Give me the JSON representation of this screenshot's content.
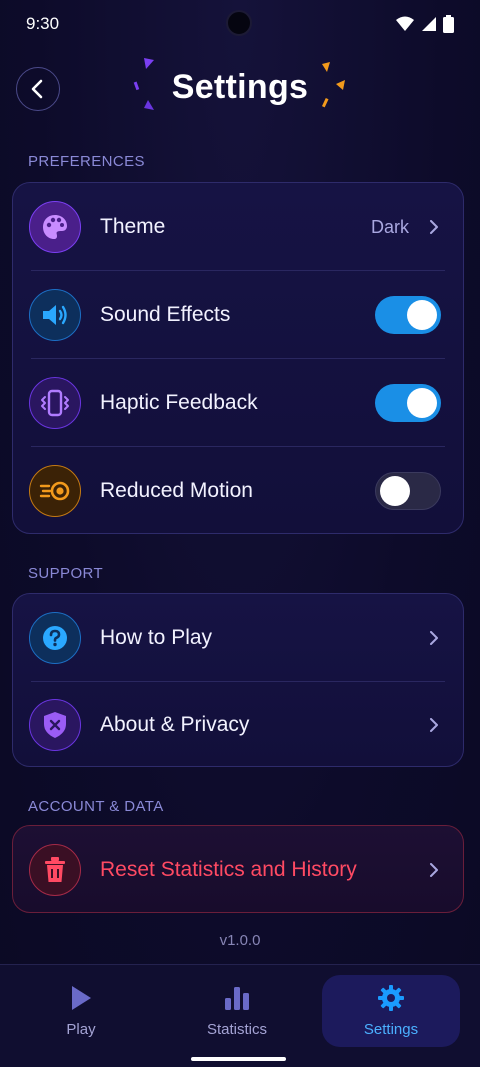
{
  "status_bar": {
    "time": "9:30"
  },
  "header": {
    "title": "Settings"
  },
  "sections": {
    "preferences": {
      "label": "PREFERENCES",
      "theme": {
        "label": "Theme",
        "value": "Dark",
        "icon": "palette-icon"
      },
      "sound_effects": {
        "label": "Sound Effects",
        "enabled": true,
        "icon": "speaker-icon"
      },
      "haptic_feedback": {
        "label": "Haptic Feedback",
        "enabled": true,
        "icon": "vibrate-icon"
      },
      "reduced_motion": {
        "label": "Reduced Motion",
        "enabled": false,
        "icon": "motion-icon"
      }
    },
    "support": {
      "label": "SUPPORT",
      "how_to_play": {
        "label": "How to Play",
        "icon": "question-icon"
      },
      "about_privacy": {
        "label": "About & Privacy",
        "icon": "shield-icon"
      }
    },
    "account": {
      "label": "ACCOUNT & DATA",
      "reset": {
        "label": "Reset Statistics and History",
        "icon": "trash-icon"
      }
    }
  },
  "version": "v1.0.0",
  "bottom_nav": {
    "play": "Play",
    "statistics": "Statistics",
    "settings": "Settings",
    "active": "settings"
  },
  "colors": {
    "background": "#0d0b2a",
    "accent_blue": "#1a8fe6",
    "danger": "#ff4a63",
    "purple": "#7b3ff2",
    "orange": "#f29a1c"
  }
}
